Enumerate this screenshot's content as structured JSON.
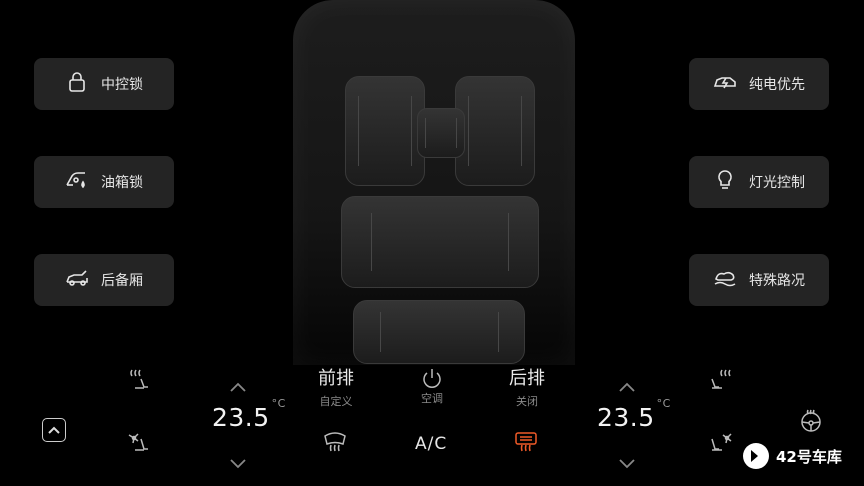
{
  "left_buttons": [
    {
      "label": "中控锁",
      "icon": "lock-icon"
    },
    {
      "label": "油箱锁",
      "icon": "fuel-cap-icon"
    },
    {
      "label": "后备厢",
      "icon": "trunk-icon"
    }
  ],
  "right_buttons": [
    {
      "label": "纯电优先",
      "icon": "ev-priority-icon"
    },
    {
      "label": "灯光控制",
      "icon": "light-bulb-icon"
    },
    {
      "label": "特殊路况",
      "icon": "terrain-icon"
    }
  ],
  "climate": {
    "left_temp": "23.5",
    "right_temp": "23.5",
    "temp_unit": "°C",
    "front_zone": {
      "title": "前排",
      "sub": "自定义"
    },
    "power": {
      "label": "空调"
    },
    "rear_zone": {
      "title": "后排",
      "sub": "关闭"
    },
    "ac_label": "A/C"
  },
  "watermark": "42号车库",
  "colors": {
    "accent_heat": "#f05a28",
    "background": "#000000",
    "button_bg": "#242424"
  }
}
